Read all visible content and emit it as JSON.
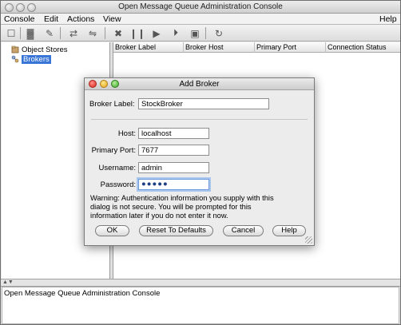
{
  "window": {
    "title": "Open Message Queue Administration Console"
  },
  "menubar": {
    "items": [
      "Console",
      "Edit",
      "Actions",
      "View"
    ],
    "help": "Help"
  },
  "toolbar": {
    "buttons": [
      {
        "icon": "new-icon",
        "glyph": "☐"
      },
      {
        "icon": "delete-icon",
        "glyph": "▓"
      },
      {
        "icon": "properties-icon",
        "glyph": "✎"
      },
      {
        "icon": "connect-icon",
        "glyph": "⇄"
      },
      {
        "icon": "disconnect-icon",
        "glyph": "⇋"
      },
      {
        "icon": "pause-all-icon",
        "glyph": "✖"
      },
      {
        "icon": "pause-icon",
        "glyph": "❙❙"
      },
      {
        "icon": "resume-icon",
        "glyph": "▶"
      },
      {
        "icon": "restart-icon",
        "glyph": "⏵"
      },
      {
        "icon": "shutdown-icon",
        "glyph": "▣"
      },
      {
        "icon": "query-icon",
        "glyph": "▤"
      },
      {
        "icon": "refresh-icon",
        "glyph": "↻"
      }
    ]
  },
  "tree": {
    "items": [
      {
        "label": "Object Stores",
        "icon": "object-stores-icon",
        "selected": false
      },
      {
        "label": "Brokers",
        "icon": "brokers-icon",
        "selected": true
      }
    ]
  },
  "table": {
    "columns": [
      "Broker Label",
      "Broker Host",
      "Primary Port",
      "Connection Status"
    ]
  },
  "status": {
    "text": "Open Message Queue Administration Console"
  },
  "dialog": {
    "title": "Add Broker",
    "broker_label": {
      "label": "Broker Label:",
      "value": "StockBroker"
    },
    "host": {
      "label": "Host:",
      "value": "localhost"
    },
    "port": {
      "label": "Primary Port:",
      "value": "7677"
    },
    "username": {
      "label": "Username:",
      "value": "admin"
    },
    "password": {
      "label": "Password:",
      "value": "●●●●●"
    },
    "warning": "Warning: Authentication information you supply with this dialog is not secure. You will be prompted for this information later if you do not enter it now.",
    "buttons": {
      "ok": "OK",
      "reset": "Reset To Defaults",
      "cancel": "Cancel",
      "help": "Help"
    }
  }
}
